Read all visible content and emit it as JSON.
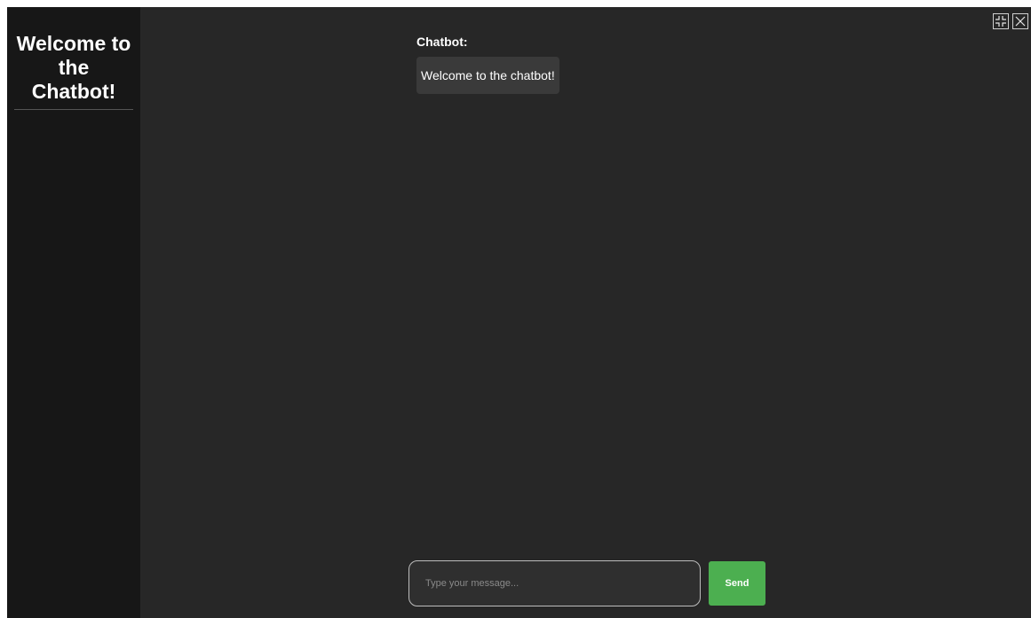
{
  "sidebar": {
    "title": "Welcome to the Chatbot!"
  },
  "window_controls": [
    {
      "icon": "minimize-icon"
    },
    {
      "icon": "close-icon"
    }
  ],
  "chat": {
    "messages": [
      {
        "sender": "Chatbot:",
        "text": "Welcome to the chatbot!"
      }
    ]
  },
  "composer": {
    "placeholder": "Type your message...",
    "value": "",
    "send_label": "Send"
  },
  "colors": {
    "background": "#272727",
    "sidebar": "#171717",
    "bubble": "#3a3a3a",
    "send_button": "#4caf50"
  }
}
